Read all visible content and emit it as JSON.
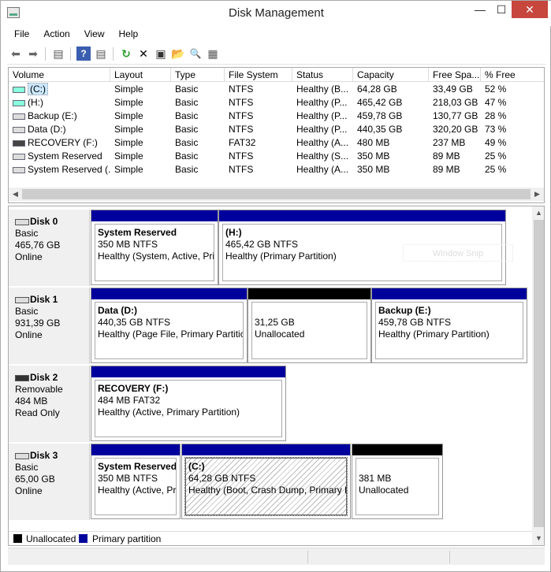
{
  "window": {
    "title": "Disk Management",
    "min": "—",
    "max": "☐",
    "close": "✕"
  },
  "menu": [
    "File",
    "Action",
    "View",
    "Help"
  ],
  "toolbar": {
    "back": "⬅",
    "forward": "➡",
    "view": "▤",
    "help": "?",
    "props": "▤",
    "refresh": "↻",
    "delete": "✕",
    "properties": "▣",
    "open": "📂",
    "search": "🔍",
    "settings": "▦"
  },
  "list": {
    "columns": [
      "Volume",
      "Layout",
      "Type",
      "File System",
      "Status",
      "Capacity",
      "Free Spa...",
      "% Free"
    ],
    "rows": [
      [
        "(C:)",
        "Simple",
        "Basic",
        "NTFS",
        "Healthy (B...",
        "64,28 GB",
        "33,49 GB",
        "52 %"
      ],
      [
        "(H:)",
        "Simple",
        "Basic",
        "NTFS",
        "Healthy (P...",
        "465,42 GB",
        "218,03 GB",
        "47 %"
      ],
      [
        "Backup (E:)",
        "Simple",
        "Basic",
        "NTFS",
        "Healthy (P...",
        "459,78 GB",
        "130,77 GB",
        "28 %"
      ],
      [
        "Data (D:)",
        "Simple",
        "Basic",
        "NTFS",
        "Healthy (P...",
        "440,35 GB",
        "320,20 GB",
        "73 %"
      ],
      [
        "RECOVERY (F:)",
        "Simple",
        "Basic",
        "FAT32",
        "Healthy (A...",
        "480 MB",
        "237 MB",
        "49 %"
      ],
      [
        "System Reserved",
        "Simple",
        "Basic",
        "NTFS",
        "Healthy (S...",
        "350 MB",
        "89 MB",
        "25 %"
      ],
      [
        "System Reserved (...",
        "Simple",
        "Basic",
        "NTFS",
        "Healthy (A...",
        "350 MB",
        "89 MB",
        "25 %"
      ]
    ]
  },
  "disks": [
    {
      "name": "Disk 0",
      "type": "Basic",
      "size": "465,76 GB",
      "state": "Online",
      "icon": "disk-icon",
      "partitions": [
        {
          "title": "System Reserved",
          "size": "350 MB NTFS",
          "status": "Healthy (System, Active, Prim",
          "bar": "blue"
        },
        {
          "title": "(H:)",
          "size": "465,42 GB NTFS",
          "status": "Healthy (Primary Partition)",
          "bar": "blue"
        }
      ]
    },
    {
      "name": "Disk 1",
      "type": "Basic",
      "size": "931,39 GB",
      "state": "Online",
      "icon": "disk-icon",
      "partitions": [
        {
          "title": "Data  (D:)",
          "size": "440,35 GB NTFS",
          "status": "Healthy (Page File, Primary Partitio",
          "bar": "blue"
        },
        {
          "title": "",
          "size": "31,25 GB",
          "status": "Unallocated",
          "bar": "black"
        },
        {
          "title": "Backup  (E:)",
          "size": "459,78 GB NTFS",
          "status": "Healthy (Primary Partition)",
          "bar": "blue"
        }
      ]
    },
    {
      "name": "Disk 2",
      "type": "Removable",
      "size": "484 MB",
      "state": "Read Only",
      "icon": "removable-disk-icon",
      "partitions": [
        {
          "title": "RECOVERY  (F:)",
          "size": "484 MB FAT32",
          "status": "Healthy (Active, Primary Partition)",
          "bar": "blue"
        }
      ]
    },
    {
      "name": "Disk 3",
      "type": "Basic",
      "size": "65,00 GB",
      "state": "Online",
      "icon": "disk-icon",
      "partitions": [
        {
          "title": "System Reserved",
          "size": "350 MB NTFS",
          "status": "Healthy (Active, Pr",
          "bar": "blue"
        },
        {
          "title": "(C:)",
          "size": "64,28 GB NTFS",
          "status": "Healthy (Boot, Crash Dump, Primary P",
          "bar": "blue"
        },
        {
          "title": "",
          "size": "381 MB",
          "status": "Unallocated",
          "bar": "black"
        }
      ]
    }
  ],
  "legend": {
    "unallocated": "Unallocated",
    "primary": "Primary partition"
  },
  "overlay": "Window Snip",
  "colors": {
    "primary": "#00009c",
    "unallocated": "#000000",
    "close": "#c7463d"
  }
}
